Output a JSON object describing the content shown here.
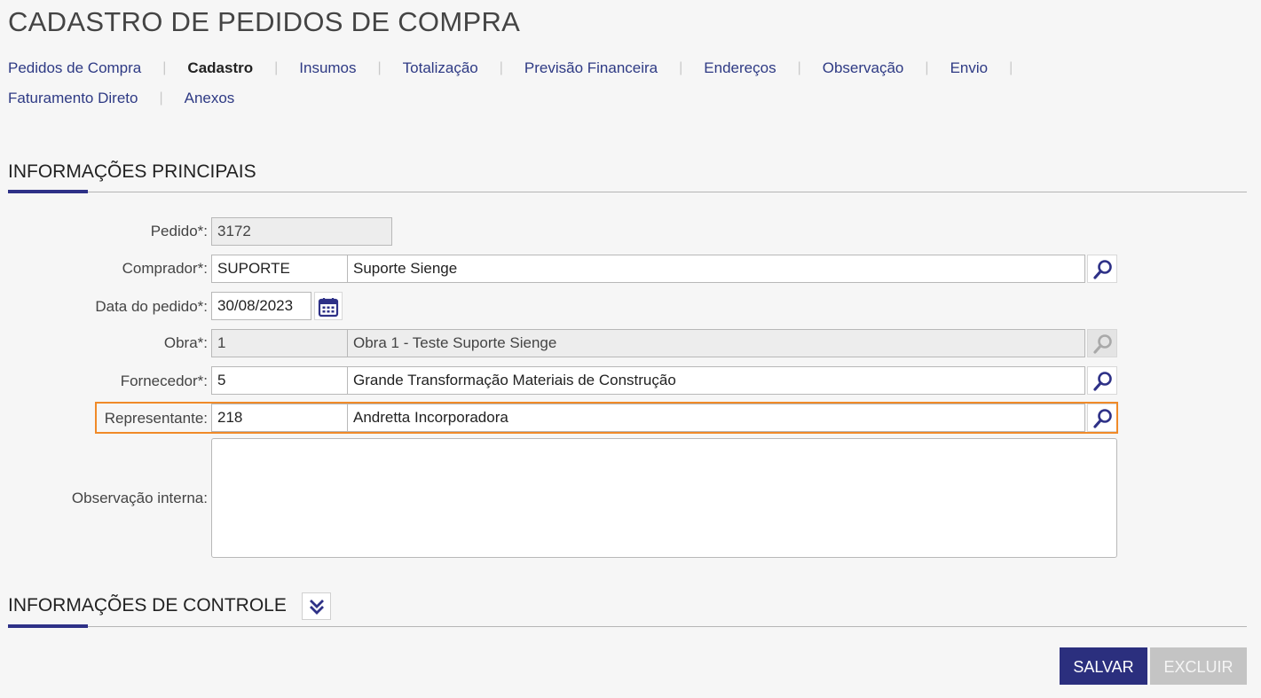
{
  "page": {
    "title": "CADASTRO DE PEDIDOS DE COMPRA"
  },
  "tabs": {
    "row1": [
      "Pedidos de Compra",
      "Cadastro",
      "Insumos",
      "Totalização",
      "Previsão Financeira",
      "Endereços",
      "Observação",
      "Envio"
    ],
    "row2": [
      "Faturamento Direto",
      "Anexos"
    ],
    "active": "Cadastro"
  },
  "sections": {
    "main_title": "INFORMAÇÕES PRINCIPAIS",
    "control_title": "INFORMAÇÕES DE CONTROLE"
  },
  "form": {
    "pedido": {
      "label": "Pedido*:",
      "value": "3172"
    },
    "comprador": {
      "label": "Comprador*:",
      "code": "SUPORTE",
      "name": "Suporte Sienge"
    },
    "data_pedido": {
      "label": "Data do pedido*:",
      "value": "30/08/2023"
    },
    "obra": {
      "label": "Obra*:",
      "code": "1",
      "name": "Obra 1 - Teste Suporte Sienge"
    },
    "fornecedor": {
      "label": "Fornecedor*:",
      "code": "5",
      "name": "Grande Transformação Materiais de Construção"
    },
    "representante": {
      "label": "Representante:",
      "code": "218",
      "name": "Andretta Incorporadora"
    },
    "observacao": {
      "label": "Observação interna:",
      "value": ""
    }
  },
  "buttons": {
    "save": "SALVAR",
    "delete": "EXCLUIR"
  },
  "colors": {
    "accent": "#2b2f7e",
    "link": "#2e3a84",
    "highlight": "#f08a28",
    "disabled_button": "#c4c4c4"
  },
  "icons": {
    "search": "magnifier-icon",
    "calendar": "calendar-icon",
    "collapse": "double-chevron-down-icon"
  }
}
